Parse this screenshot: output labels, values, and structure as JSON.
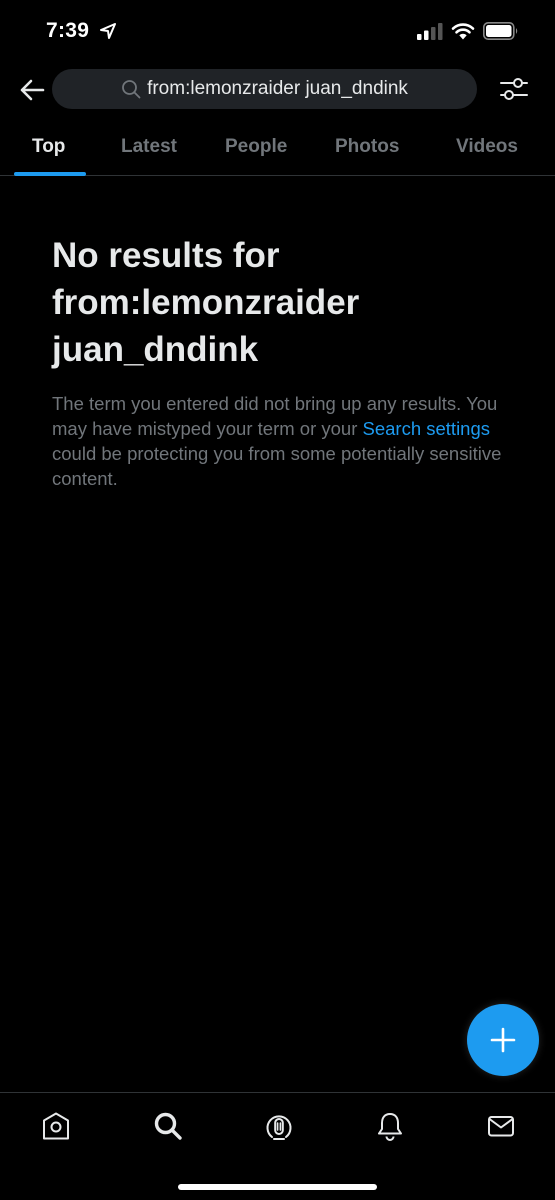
{
  "status_bar": {
    "time": "7:39"
  },
  "search": {
    "query": "from:lemonzraider juan_dndink"
  },
  "tabs": [
    {
      "label": "Top",
      "active": true
    },
    {
      "label": "Latest",
      "active": false
    },
    {
      "label": "People",
      "active": false
    },
    {
      "label": "Photos",
      "active": false
    },
    {
      "label": "Videos",
      "active": false
    }
  ],
  "empty_state": {
    "title": "No results for from:lemonzraider juan_dndink",
    "body_before_link": "The term you entered did not bring up any results. You may have mistyped your term or your ",
    "link_text": "Search settings",
    "body_after_link": " could be protecting you from some potentially sensitive content."
  },
  "icons": {
    "back": "arrow-left-icon",
    "search": "search-icon",
    "filter": "sliders-icon",
    "compose": "plus-icon",
    "home": "home-icon",
    "explore": "search-icon",
    "spaces": "spaces-icon",
    "notifications": "bell-icon",
    "messages": "envelope-icon"
  },
  "colors": {
    "accent": "#1d9bf0",
    "background": "#000000",
    "text": "#e7e9ea",
    "muted": "#71767b"
  }
}
